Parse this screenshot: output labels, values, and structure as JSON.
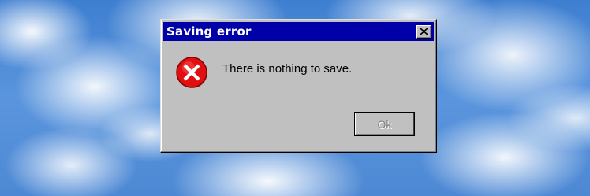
{
  "dialog": {
    "title": "Saving error",
    "message": "There is nothing to save.",
    "ok_label": "Ok",
    "close_icon": "close-icon",
    "status_icon": "error-icon"
  },
  "colors": {
    "titlebar": "#0000a8",
    "dialog_face": "#c0c0c0",
    "error_red": "#e01010",
    "sky": "#4d88d4"
  }
}
